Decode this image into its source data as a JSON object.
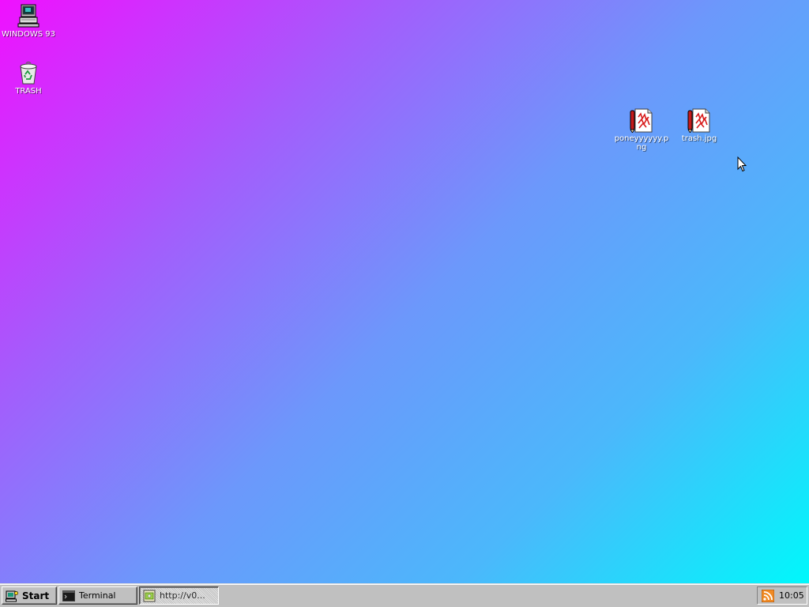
{
  "desktop": {
    "background": {
      "from": "#f010ff",
      "mid": "#6c98fb",
      "to": "#00f8fb"
    },
    "icons": [
      {
        "label": "WINDOWS 93",
        "icon": "computer-icon"
      },
      {
        "label": "TRASH",
        "icon": "recycle-bin-icon"
      },
      {
        "label": "poneyyyyyy.png",
        "icon": "image-file-icon"
      },
      {
        "label": "trash.jpg",
        "icon": "image-file-icon"
      }
    ]
  },
  "taskbar": {
    "start_label": "Start",
    "tasks": [
      {
        "label": "Terminal",
        "icon": "terminal-icon",
        "active": false
      },
      {
        "label": "http://v0...",
        "icon": "browser-icon",
        "active": true
      }
    ],
    "tray": {
      "icon": "rss-icon",
      "clock": "10:05"
    }
  },
  "colors": {
    "taskbar": "#c0c0c0",
    "rss": "#f08a24"
  }
}
